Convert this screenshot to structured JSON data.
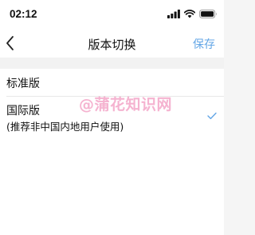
{
  "status_bar": {
    "time": "02:12",
    "icons": [
      "signal-icon",
      "wifi-icon",
      "battery-icon"
    ]
  },
  "nav": {
    "back_icon": "chevron-left-icon",
    "title": "版本切换",
    "save_label": "保存"
  },
  "options": [
    {
      "label": "标准版",
      "selected": false
    },
    {
      "label": "国际版",
      "sublabel": "(推荐非中国内地用户使用)",
      "selected": true
    }
  ],
  "watermark": "@蒲花知识网",
  "colors": {
    "accent": "#63a6e6",
    "background": "#f5f5f5",
    "divider": "#e8e8e8",
    "watermark": "#ec74aa"
  }
}
